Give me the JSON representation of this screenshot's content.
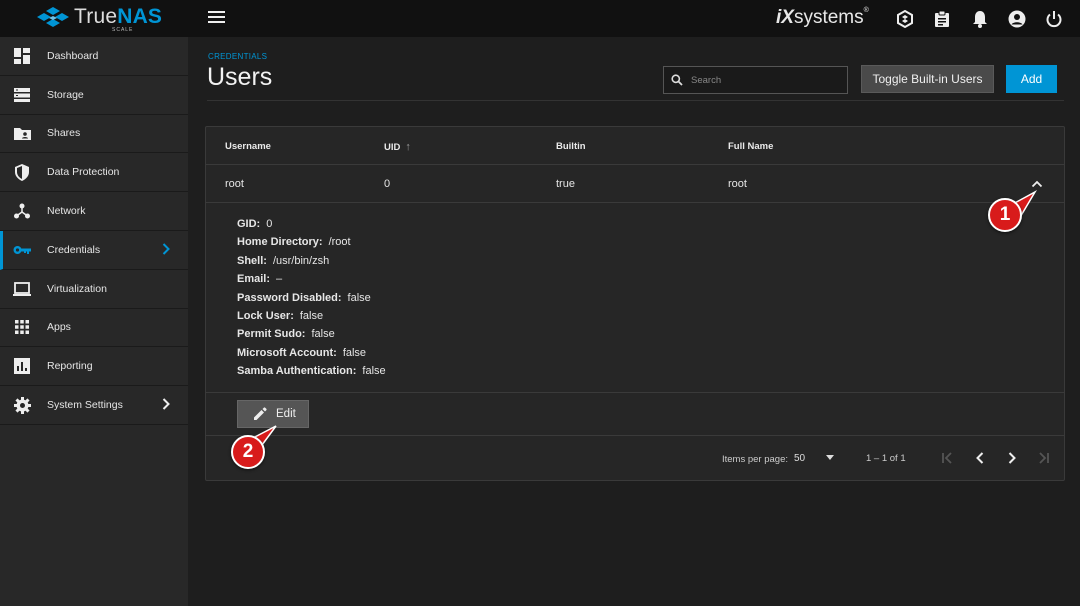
{
  "topbar": {
    "brand_prefix": "True",
    "brand_suffix": "NAS",
    "brand_sub": "SCALE",
    "vendor_ix": "iX",
    "vendor_name": "systems",
    "vendor_tm": "®",
    "icons": [
      "truecommand-icon",
      "clipboard-icon",
      "bell-icon",
      "account-circle-icon",
      "power-icon"
    ]
  },
  "sidebar": {
    "items": [
      {
        "label": "Dashboard",
        "icon": "dashboard-icon"
      },
      {
        "label": "Storage",
        "icon": "storage-icon"
      },
      {
        "label": "Shares",
        "icon": "shares-folder-icon"
      },
      {
        "label": "Data Protection",
        "icon": "shield-icon"
      },
      {
        "label": "Network",
        "icon": "network-icon"
      },
      {
        "label": "Credentials",
        "icon": "key-icon",
        "active": true,
        "chevron": "›"
      },
      {
        "label": "Virtualization",
        "icon": "laptop-icon"
      },
      {
        "label": "Apps",
        "icon": "apps-grid-icon"
      },
      {
        "label": "Reporting",
        "icon": "chart-icon"
      },
      {
        "label": "System Settings",
        "icon": "gear-icon",
        "chevron": "›"
      }
    ]
  },
  "header": {
    "breadcrumb": "CREDENTIALS",
    "title": "Users",
    "search_placeholder": "Search",
    "toggle_label": "Toggle Built-in Users",
    "add_label": "Add"
  },
  "table": {
    "columns": [
      "Username",
      "UID",
      "Builtin",
      "Full Name"
    ],
    "sort_arrow": "↑",
    "row": {
      "username": "root",
      "uid": "0",
      "builtin": "true",
      "full_name": "root"
    }
  },
  "details": [
    {
      "key": "GID:",
      "value": "0"
    },
    {
      "key": "Home Directory:",
      "value": "/root"
    },
    {
      "key": "Shell:",
      "value": "/usr/bin/zsh"
    },
    {
      "key": "Email:",
      "value": "–"
    },
    {
      "key": "Password Disabled:",
      "value": "false"
    },
    {
      "key": "Lock User:",
      "value": "false"
    },
    {
      "key": "Permit Sudo:",
      "value": "false"
    },
    {
      "key": "Microsoft Account:",
      "value": "false"
    },
    {
      "key": "Samba Authentication:",
      "value": "false"
    }
  ],
  "edit_label": "Edit",
  "pager": {
    "items_per_page_label": "Items per page:",
    "items_per_page_value": "50",
    "range": "1 – 1 of 1"
  },
  "callouts": [
    "1",
    "2"
  ],
  "colors": {
    "accent": "#0095d5",
    "callout": "#d81b1b"
  }
}
